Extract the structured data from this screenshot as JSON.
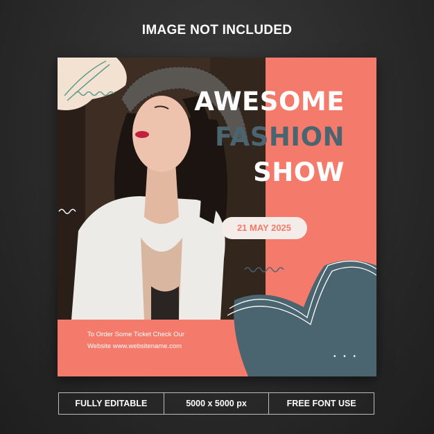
{
  "banner": {
    "title": "IMAGE NOT INCLUDED"
  },
  "post": {
    "headline_line1": "AWESOME",
    "headline_line2": "FASHION",
    "headline_line3": "SHOW",
    "date": "21 MAY 2025",
    "order_line1": "To Order  Some Ticket Check Our",
    "order_line2": "Website www.websitename.com",
    "dots": "• • •"
  },
  "colors": {
    "coral": "#f47b6b",
    "slate": "#4a6470",
    "cream": "#f3e2d2",
    "teal_line": "#5e9a8a"
  },
  "footer": {
    "items": [
      "FULLY EDITABLE",
      "5000 x 5000 px",
      "FREE FONT USE"
    ]
  }
}
